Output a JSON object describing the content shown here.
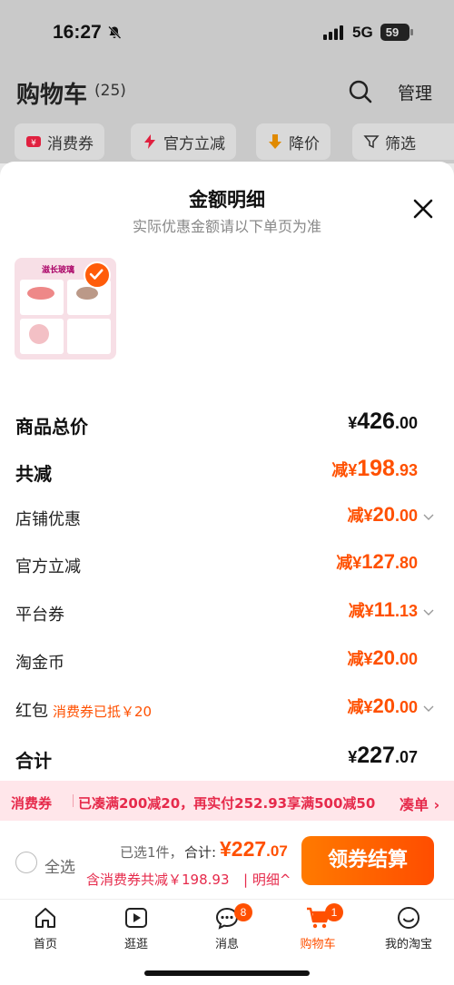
{
  "status_bar": {
    "time": "16:27",
    "network": "5G",
    "battery": "59"
  },
  "cart_header": {
    "title": "购物车",
    "count": "(25)",
    "manage_label": "管理",
    "chips": [
      {
        "label": "消费券",
        "icon": "coupon-icon"
      },
      {
        "label": "官方立减",
        "icon": "lightning-icon"
      },
      {
        "label": "降价",
        "icon": "price-drop-icon"
      },
      {
        "label": "筛选",
        "icon": "filter-icon"
      }
    ]
  },
  "sheet": {
    "title": "金额明细",
    "subtitle": "实际优惠金额请以下单页为准",
    "product_thumb": {
      "brand_text": "滋长玻璃",
      "selected": true
    }
  },
  "breakdown": {
    "total_price": {
      "label": "商品总价",
      "currency": "¥",
      "int": "426",
      "dec": ".00"
    },
    "total_discount": {
      "label": "共减",
      "prefix": "减¥",
      "int": "198",
      "dec": ".93"
    },
    "shop_discount": {
      "label": "店铺优惠",
      "prefix": "减¥",
      "int": "20",
      "dec": ".00"
    },
    "official_discount": {
      "label": "官方立减",
      "prefix": "减¥",
      "int": "127",
      "dec": ".80"
    },
    "platform_coupon": {
      "label": "平台券",
      "prefix": "减¥",
      "int": "11",
      "dec": ".13"
    },
    "taojinbi": {
      "label": "淘金币",
      "prefix": "减¥",
      "int": "20",
      "dec": ".00"
    },
    "red_packet": {
      "label": "红包",
      "tag": "消费券已抵￥20",
      "prefix": "减¥",
      "int": "20",
      "dec": ".00"
    },
    "sum": {
      "label": "合计",
      "currency": "¥",
      "int": "227",
      "dec": ".07"
    }
  },
  "coupon_strip": {
    "label": "消费券",
    "text": "已凑满200减20，再实付252.93享满500减50",
    "link": "凑单 ›"
  },
  "checkout": {
    "select_all": "全选",
    "selected_count": "已选1件，",
    "total_label": "合计:",
    "total_int": "¥227",
    "total_dec": ".07",
    "discount_info": "含消费券共减￥198.93",
    "detail_toggle": "| 明细^",
    "button_label": "领券结算"
  },
  "tabbar": {
    "items": [
      {
        "label": "首页",
        "icon": "home-icon",
        "active": false
      },
      {
        "label": "逛逛",
        "icon": "video-icon",
        "active": false
      },
      {
        "label": "消息",
        "icon": "message-icon",
        "badge": "8",
        "active": false
      },
      {
        "label": "购物车",
        "icon": "cart-icon",
        "badge": "1",
        "active": true
      },
      {
        "label": "我的淘宝",
        "icon": "profile-icon",
        "active": false
      }
    ]
  },
  "colors": {
    "accent": "#ff5000",
    "coupon_red": "#e62a4b",
    "coupon_bg": "#ffe6ea"
  }
}
